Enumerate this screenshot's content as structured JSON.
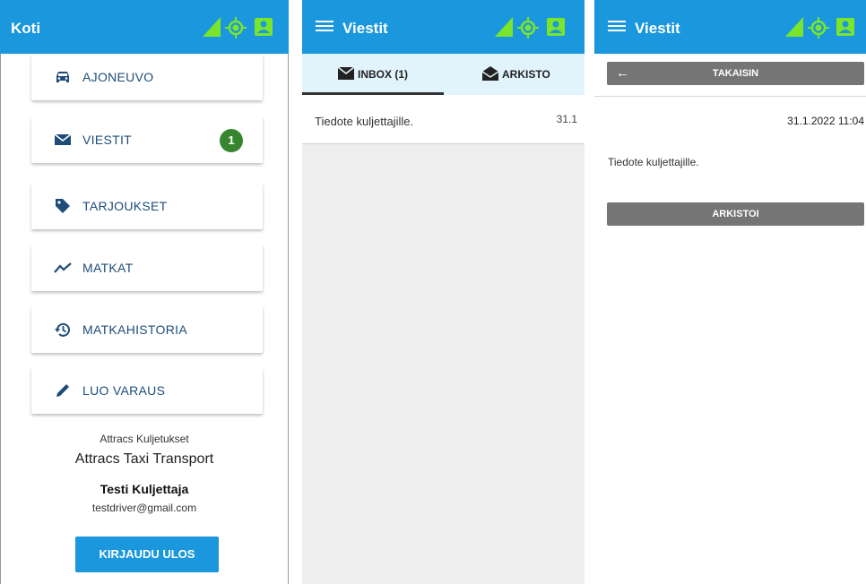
{
  "colors": {
    "topbar": "#1a97dd",
    "accent_green": "#7be52c",
    "badge": "#37862f",
    "card_text": "#1e4c79",
    "button_grey": "#757575",
    "tab_bar": "#e1f3fb"
  },
  "home": {
    "title": "Koti",
    "menu_items": [
      {
        "label": "AJONEUVO",
        "icon": "car-icon"
      },
      {
        "label": "VIESTIT",
        "icon": "mail-icon",
        "badge": "1"
      },
      {
        "label": "TARJOUKSET",
        "icon": "tag-icon"
      },
      {
        "label": "MATKAT",
        "icon": "trending-icon"
      },
      {
        "label": "MATKAHISTORIA",
        "icon": "history-icon"
      },
      {
        "label": "LUO VARAUS",
        "icon": "pencil-icon"
      }
    ],
    "company_small": "Attracs Kuljetukset",
    "company_large": "Attracs Taxi Transport",
    "user_name": "Testi Kuljettaja",
    "user_email": "testdriver@gmail.com",
    "logout_label": "KIRJAUDU ULOS"
  },
  "inbox": {
    "title": "Viestit",
    "tabs": [
      {
        "label": "INBOX (1)",
        "icon": "mail-icon"
      },
      {
        "label": "ARKISTO",
        "icon": "drafts-icon"
      }
    ],
    "messages": [
      {
        "subject": "Tiedote kuljettajille.",
        "date": "31.1"
      }
    ]
  },
  "detail": {
    "title": "Viestit",
    "back_label": "TAKAISIN",
    "datetime": "31.1.2022 11:04",
    "body": "Tiedote kuljettajille.",
    "archive_label": "ARKISTOI"
  }
}
